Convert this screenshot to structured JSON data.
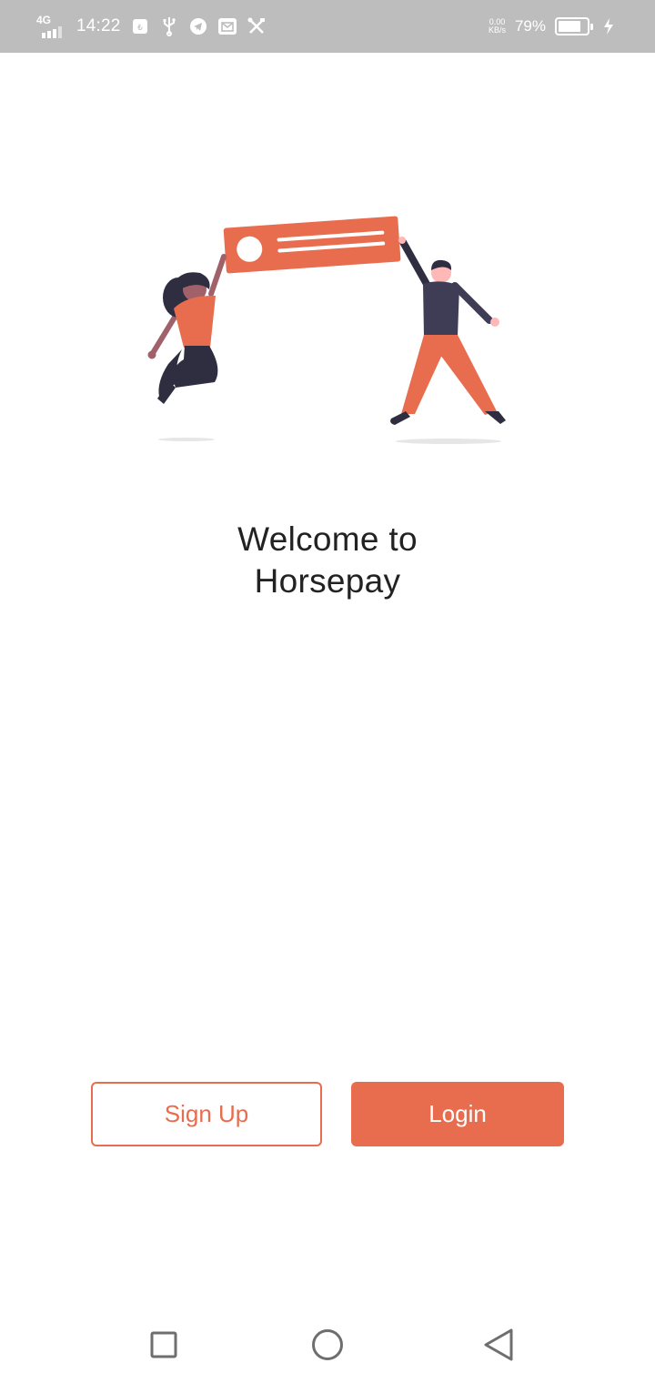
{
  "status_bar": {
    "network": "4G",
    "time": "14:22",
    "speed_value": "0.00",
    "speed_unit": "KB/s",
    "battery_percent": "79%",
    "battery_level": 0.79
  },
  "welcome": {
    "line1": "Welcome to",
    "line2": "Horsepay"
  },
  "buttons": {
    "signup_label": "Sign Up",
    "login_label": "Login"
  },
  "colors": {
    "accent": "#e86d4f",
    "dark": "#3f3d56",
    "text": "#222222",
    "status_bar": "#bdbdbd"
  }
}
